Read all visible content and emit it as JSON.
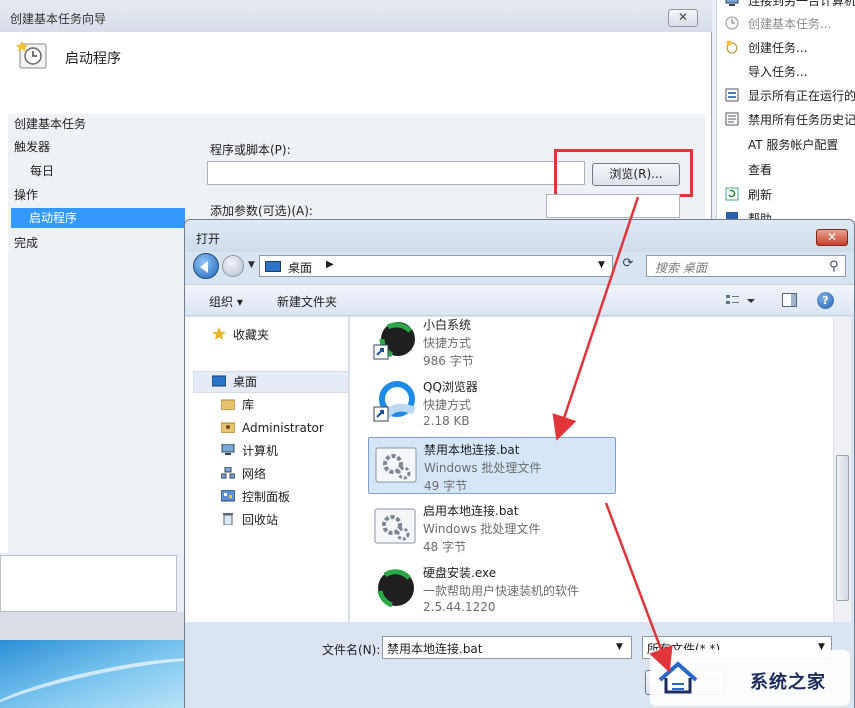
{
  "wizard": {
    "title": "创建基本任务向导",
    "header_title": "启动程序",
    "nav": {
      "create_basic_task": "创建基本任务",
      "trigger": "触发器",
      "daily": "每日",
      "action": "操作",
      "start_program": "启动程序",
      "finish": "完成"
    },
    "program_label": "程序或脚本(P):",
    "program_value": "",
    "browse_label": "浏览(R)...",
    "args_label": "添加参数(可选)(A):",
    "args_value": ""
  },
  "action_pane": {
    "items": [
      {
        "label": "连接到另一台计算机",
        "icon": "computer-icon",
        "disabled": false
      },
      {
        "label": "创建基本任务...",
        "icon": "task-wizard-icon",
        "disabled": true
      },
      {
        "label": "创建任务...",
        "icon": "create-task-icon",
        "disabled": false
      },
      {
        "label": "导入任务...",
        "icon": "",
        "disabled": false
      },
      {
        "label": "显示所有正在运行的任务",
        "icon": "running-tasks-icon",
        "disabled": false
      },
      {
        "label": "禁用所有任务历史记录",
        "icon": "history-icon",
        "disabled": false
      },
      {
        "label": "AT 服务帐户配置",
        "icon": "",
        "disabled": false
      },
      {
        "label": "查看",
        "icon": "",
        "disabled": false
      },
      {
        "label": "刷新",
        "icon": "refresh-icon",
        "disabled": false
      },
      {
        "label": "帮助",
        "icon": "help-icon",
        "disabled": false
      }
    ]
  },
  "open_dialog": {
    "title": "打开",
    "address": "桌面",
    "search_placeholder": "搜索 桌面",
    "toolbar": {
      "organize": "组织 ▾",
      "new_folder": "新建文件夹"
    },
    "nav": {
      "favorites": "收藏夹",
      "desktop": "桌面",
      "libraries": "库",
      "administrator": "Administrator",
      "computer": "计算机",
      "network": "网络",
      "control_panel": "控制面板",
      "recycle_bin": "回收站"
    },
    "files": [
      {
        "name": "小白系统",
        "type": "快捷方式",
        "size": "986 字节",
        "icon": "xiaobai-shortcut-icon"
      },
      {
        "name": "QQ浏览器",
        "type": "快捷方式",
        "size": "2.18 KB",
        "icon": "qq-browser-icon"
      },
      {
        "name": "禁用本地连接.bat",
        "type": "Windows 批处理文件",
        "size": "49 字节",
        "icon": "batch-file-icon",
        "selected": true
      },
      {
        "name": "启用本地连接.bat",
        "type": "Windows 批处理文件",
        "size": "48 字节",
        "icon": "batch-file-icon"
      },
      {
        "name": "硬盘安装.exe",
        "type": "一款帮助用户快速装机的软件",
        "size": "2.5.44.1220",
        "icon": "installer-icon"
      }
    ],
    "filename_label": "文件名(N):",
    "filename_value": "禁用本地连接.bat",
    "filetype_value": "所有文件(*.*)"
  },
  "watermark": {
    "text": "系统之家"
  },
  "colors": {
    "highlight": "#e0353a",
    "selection": "#3399ff",
    "dialog_frame": "#d8e4f1"
  }
}
